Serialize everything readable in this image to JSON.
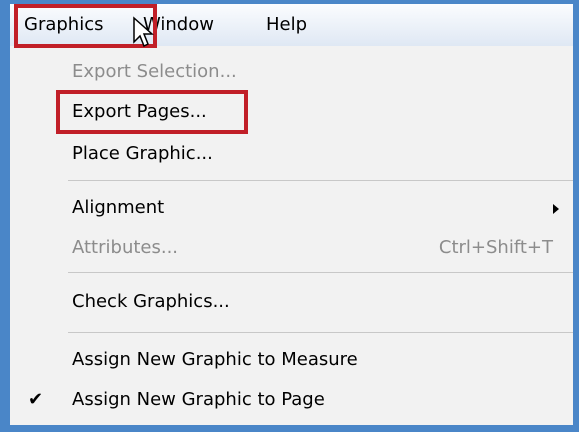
{
  "menubar": {
    "items": [
      {
        "label": "Graphics"
      },
      {
        "label": "Window"
      },
      {
        "label": "Help"
      }
    ]
  },
  "dropdown": {
    "items": [
      {
        "label": "Export Selection...",
        "enabled": false
      },
      {
        "label": "Export Pages...",
        "enabled": true
      },
      {
        "label": "Place Graphic...",
        "enabled": true
      },
      {
        "label": "Alignment",
        "enabled": true,
        "submenu": true
      },
      {
        "label": "Attributes...",
        "enabled": false,
        "shortcut": "Ctrl+Shift+T"
      },
      {
        "label": "Check Graphics...",
        "enabled": true
      },
      {
        "label": "Assign New Graphic to Measure",
        "enabled": true
      },
      {
        "label": "Assign New Graphic to Page",
        "enabled": true,
        "checked": true
      }
    ]
  },
  "colors": {
    "highlight": "#c11f28",
    "frame": "#4a86c8"
  }
}
